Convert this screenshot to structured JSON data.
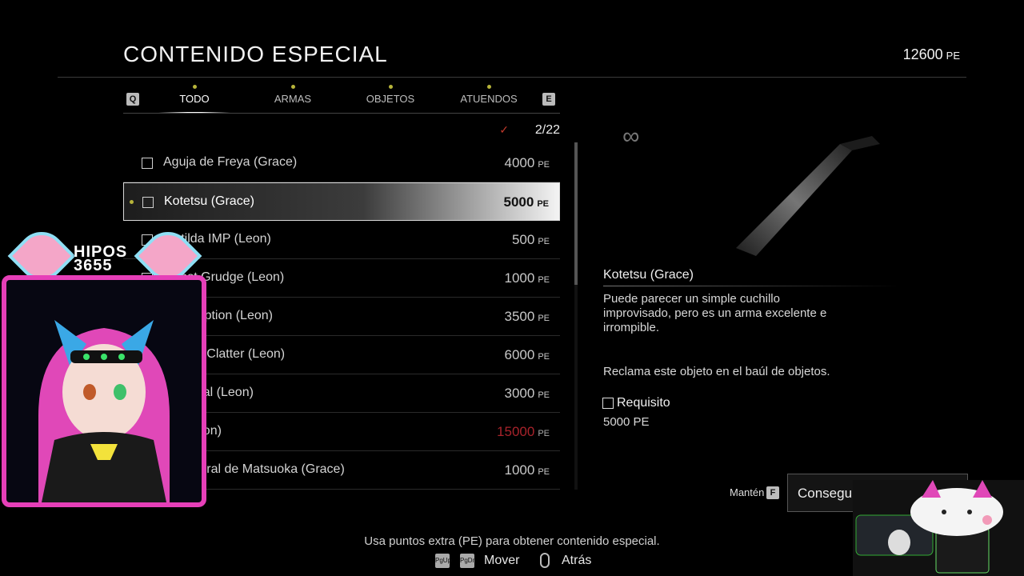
{
  "header": {
    "title": "CONTENIDO ESPECIAL",
    "points_value": "12600",
    "points_unit": "PE"
  },
  "tabs": {
    "prev_key": "Q",
    "next_key": "E",
    "items": [
      {
        "label": "TODO",
        "active": true
      },
      {
        "label": "ARMAS",
        "active": false
      },
      {
        "label": "OBJETOS",
        "active": false
      },
      {
        "label": "ATUENDOS",
        "active": false
      }
    ]
  },
  "list": {
    "check_glyph": "✓",
    "count": "2/22",
    "unit": "PE",
    "items": [
      {
        "name": "Aguja de Freya (Grace)",
        "price": "4000"
      },
      {
        "name": "Kotetsu (Grace)",
        "price": "5000",
        "selected": true
      },
      {
        "name": "Matilda IMP (Leon)",
        "price": "500"
      },
      {
        "name": "Ghost Grudge (Leon)",
        "price": "1000"
      },
      {
        "name": "Redemption (Leon)",
        "price": "3500"
      },
      {
        "name": "Sabina Clatter (Leon)",
        "price": "6000"
      },
      {
        "name": "Immortal (Leon)",
        "price": "3000"
      },
      {
        "name": "M7 (Leon)",
        "price": "15000",
        "unaffordable": true
      },
      {
        "name": "El general de Matsuoka (Grace)",
        "price": "1000"
      }
    ]
  },
  "detail": {
    "infinity_glyph": "∞",
    "name": "Kotetsu (Grace)",
    "description": "Puede parecer un simple cuchillo improvisado, pero es un arma excelente e irrompible.",
    "claim_note": "Reclama este objeto en el baúl de objetos.",
    "requirement_label": "Requisito",
    "requirement_value": "5000 PE"
  },
  "action": {
    "hold_label": "Mantén",
    "hold_key": "F",
    "button_label": "Conseguir por:"
  },
  "footer": {
    "hint": "Usa puntos extra (PE) para obtener contenido especial.",
    "key_pgup": "PgUp",
    "key_pgdn": "PgDn",
    "move_label": "Mover",
    "back_label": "Atrás"
  },
  "overlay": {
    "brand_line1": "HIPOS",
    "brand_line2": "3655"
  },
  "colors": {
    "accent_dot": "#b7b43a",
    "unaffordable_price": "#a8232b",
    "overlay_pink": "#e63fb8"
  }
}
